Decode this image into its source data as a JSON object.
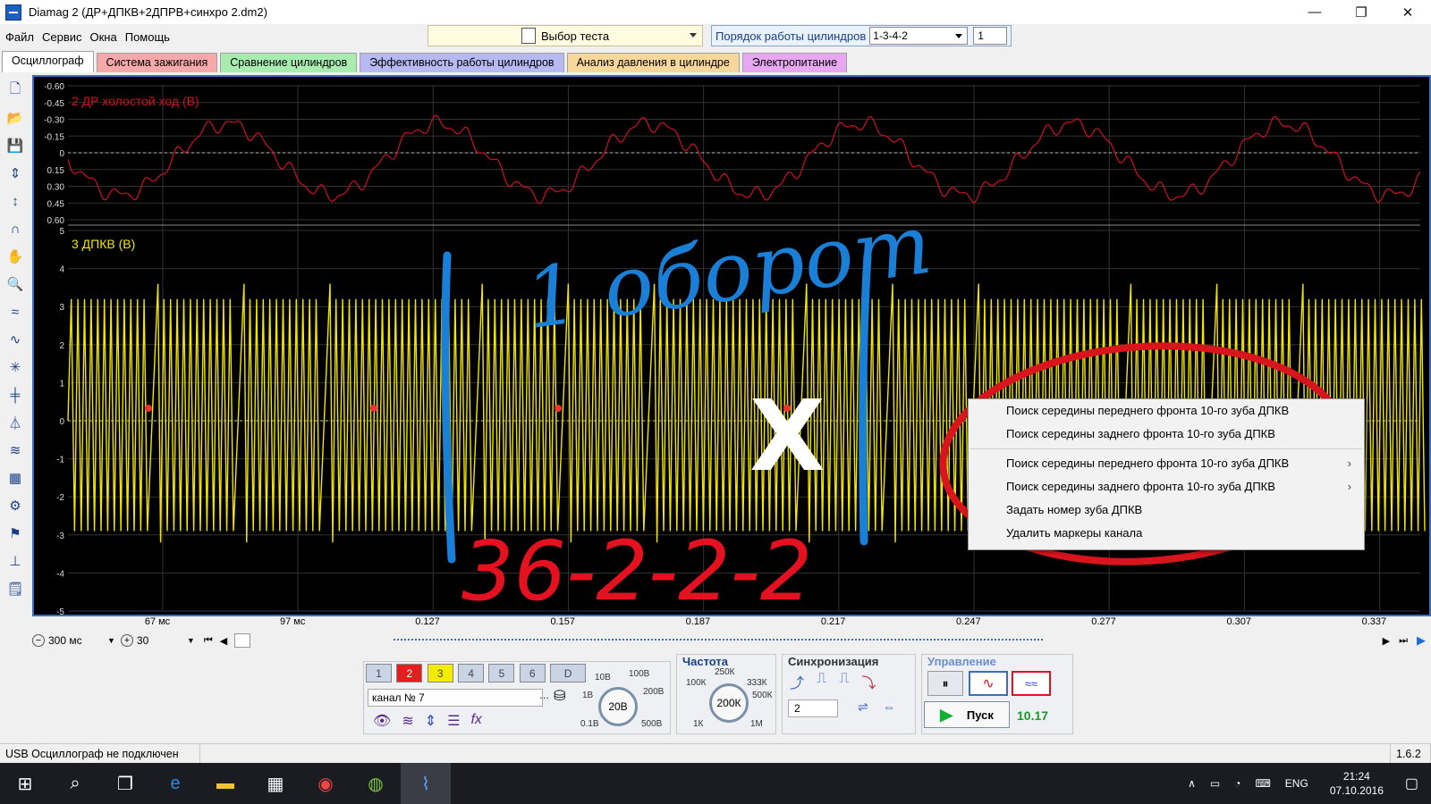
{
  "window": {
    "title": "Diamag 2 (ДР+ДПКВ+2ДПРВ+синхро 2.dm2)",
    "controls": [
      "—",
      "❐",
      "✕"
    ]
  },
  "menu": [
    "Файл",
    "Сервис",
    "Окна",
    "Помощь"
  ],
  "test_select": {
    "label": "Выбор теста"
  },
  "cylinder_order": {
    "label": "Порядок работы цилиндров",
    "value": "1-3-4-2",
    "spin": "1"
  },
  "tabs": [
    {
      "label": "Осциллограф",
      "color": "#ffffff"
    },
    {
      "label": "Система зажигания",
      "color": "#f7a9a9"
    },
    {
      "label": "Сравнение цилиндров",
      "color": "#a9ecb0"
    },
    {
      "label": "Эффективность работы цилиндров",
      "color": "#b6b9f2"
    },
    {
      "label": "Анализ давления в цилиндре",
      "color": "#f7d79a"
    },
    {
      "label": "Электропитание",
      "color": "#e7a7f2"
    }
  ],
  "left_tools": [
    "new-file-icon",
    "open-folder-icon",
    "save-icon",
    "auto-scale-icon",
    "vertical-scale-icon",
    "curve-icon",
    "hand-icon",
    "zoom-icon",
    "waves-icon",
    "waves-icon-2",
    "crosshair-icon",
    "cursor-lines-icon",
    "filter-icon",
    "channel-icon",
    "grid-icon",
    "auto-icon",
    "flag-icon",
    "zero-icon",
    "notes-icon"
  ],
  "top_channel": {
    "label": "2 ДР холостой ход (В)",
    "ticks": [
      "-0.60",
      "-0.45",
      "-0.30",
      "-0.15",
      "0",
      "0.15",
      "0.30",
      "0.45",
      "0.60"
    ],
    "color": "#d01020"
  },
  "bottom_channel": {
    "label": "3 ДПКВ (В)",
    "ticks": [
      "5",
      "4",
      "3",
      "2",
      "1",
      "0",
      "-1",
      "-2",
      "-3",
      "-4",
      "-5"
    ],
    "color": "#f2e600"
  },
  "x_ticks": [
    "67 мс",
    "97 мс",
    "0.127",
    "0.157",
    "0.187",
    "0.217",
    "0.247",
    "0.277",
    "0.307",
    "0.337"
  ],
  "annotations": {
    "top_text": "1 оборот",
    "bottom_text": "36-2-2-2",
    "mark": "X"
  },
  "context_menu": {
    "items": [
      {
        "label": "Поиск середины переднего фронта 10-го зуба ДПКВ",
        "submenu": false
      },
      {
        "label": "Поиск середины заднего фронта 10-го зуба ДПКВ",
        "submenu": false
      },
      {
        "label": "Поиск середины переднего фронта 10-го зуба ДПКВ",
        "submenu": true
      },
      {
        "label": "Поиск середины заднего фронта 10-го зуба ДПКВ",
        "submenu": true
      },
      {
        "label": "Задать номер зуба ДПКВ",
        "submenu": false
      },
      {
        "label": "Удалить маркеры канала",
        "submenu": false
      }
    ]
  },
  "timebar": {
    "timebase": "300 мс",
    "count": "30"
  },
  "control": {
    "channels": [
      "1",
      "2",
      "3",
      "4",
      "5",
      "6",
      "D"
    ],
    "channel_name": "канал № 7",
    "frequency_label": "Частота",
    "sync_label": "Синхронизация",
    "control_label": "Управление",
    "volt_value": "20В",
    "volt_ticks": [
      "10В",
      "100В",
      "1В",
      "200В",
      "0.1В",
      "500В"
    ],
    "freq_value": "200К",
    "freq_ticks": [
      "250К",
      "100К",
      "333К",
      "500К",
      "1К",
      "1М"
    ],
    "sync_value": "2",
    "start_label": "Пуск",
    "reading": "10.17"
  },
  "status": {
    "left": "USB Осциллограф не подключен",
    "version": "1.6.2"
  },
  "taskbar": {
    "lang": "ENG",
    "time": "21:24",
    "date": "07.10.2016"
  }
}
